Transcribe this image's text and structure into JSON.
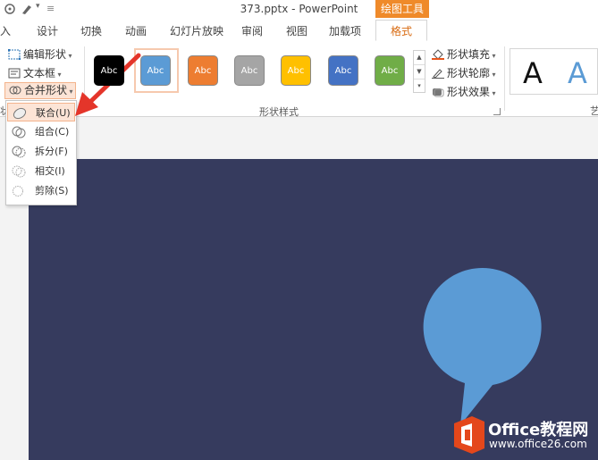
{
  "window": {
    "title": "373.pptx - PowerPoint",
    "context_tab_group": "绘图工具"
  },
  "tabs": [
    {
      "label": "入"
    },
    {
      "label": "设计"
    },
    {
      "label": "切换"
    },
    {
      "label": "动画"
    },
    {
      "label": "幻灯片放映"
    },
    {
      "label": "审阅"
    },
    {
      "label": "视图"
    },
    {
      "label": "加载项"
    },
    {
      "label": "格式"
    }
  ],
  "ribbon": {
    "edit_shape": "编辑形状",
    "text_box": "文本框",
    "merge_shapes": "合并形状",
    "shape_fill": "形状填充",
    "shape_outline": "形状轮廓",
    "shape_effects": "形状效果",
    "shape_styles_group": "形状样式",
    "left_cut_label": "状",
    "right_cut_label": "艺",
    "swatch_text": "Abc",
    "swatch_colors": [
      "#000000",
      "#5b9bd5",
      "#ed7d31",
      "#a5a5a5",
      "#ffc000",
      "#4472c4",
      "#70ad47"
    ],
    "wordart_samples": [
      "A",
      "A"
    ]
  },
  "merge_menu": {
    "items": [
      {
        "label": "联合(U)",
        "selected": true
      },
      {
        "label": "组合(C)"
      },
      {
        "label": "拆分(F)"
      },
      {
        "label": "相交(I)"
      },
      {
        "label": "剪除(S)"
      }
    ]
  },
  "slide": {
    "background": "#363b5e",
    "callout_color": "#5b9bd5"
  },
  "watermark": {
    "brand": "Office教程网",
    "url": "www.office26.com"
  }
}
